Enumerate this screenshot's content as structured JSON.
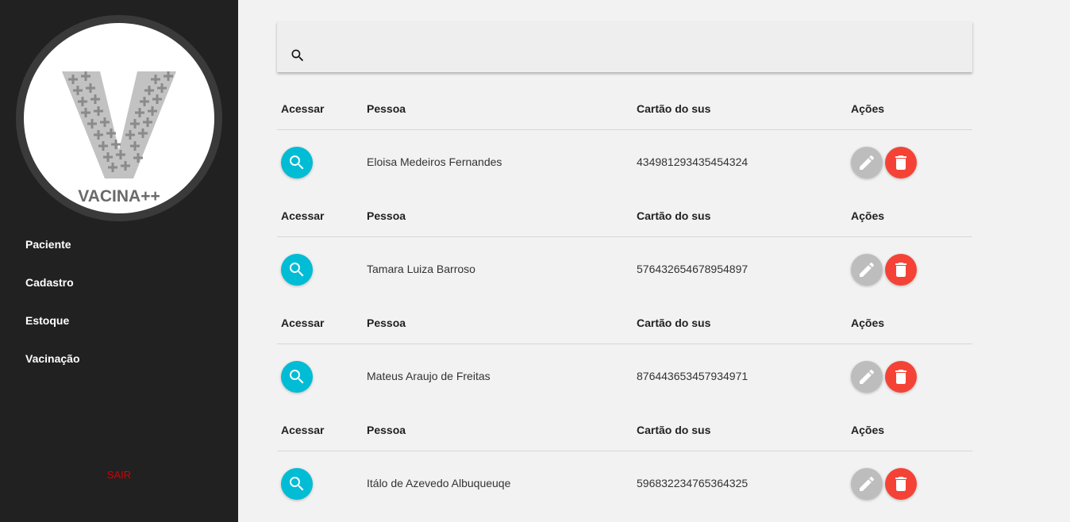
{
  "logo": {
    "text": "VACINA++"
  },
  "sidebar": {
    "items": [
      {
        "label": "Paciente"
      },
      {
        "label": "Cadastro"
      },
      {
        "label": "Estoque"
      },
      {
        "label": "Vacinação"
      }
    ],
    "logout": "SAIR"
  },
  "search": {
    "placeholder": "",
    "value": ""
  },
  "table": {
    "headers": {
      "access": "Acessar",
      "person": "Pessoa",
      "card": "Cartão do sus",
      "actions": "Ações"
    },
    "rows": [
      {
        "name": "Eloisa Medeiros Fernandes",
        "card": "434981293435454324"
      },
      {
        "name": "Tamara Luiza Barroso",
        "card": "576432654678954897"
      },
      {
        "name": "Mateus Araujo de Freitas",
        "card": "876443653457934971"
      },
      {
        "name": "Itálo de Azevedo Albuqueuqe",
        "card": "596832234765364325"
      }
    ]
  },
  "colors": {
    "sidebar_bg": "#212121",
    "view_button": "#00bcd4",
    "edit_button": "#bdbdbd",
    "delete_button": "#f44336",
    "logout_text": "#d50000"
  }
}
